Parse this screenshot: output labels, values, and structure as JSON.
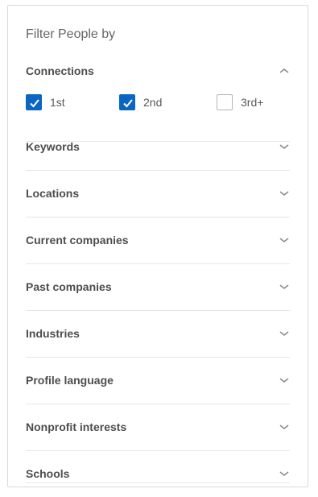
{
  "panel": {
    "title": "Filter People by"
  },
  "connections": {
    "label": "Connections",
    "expanded": true,
    "options": [
      {
        "label": "1st",
        "checked": true
      },
      {
        "label": "2nd",
        "checked": true
      },
      {
        "label": "3rd+",
        "checked": false
      }
    ]
  },
  "filters": [
    {
      "label": "Keywords"
    },
    {
      "label": "Locations"
    },
    {
      "label": "Current companies"
    },
    {
      "label": "Past companies"
    },
    {
      "label": "Industries"
    },
    {
      "label": "Profile language"
    },
    {
      "label": "Nonprofit interests"
    },
    {
      "label": "Schools"
    }
  ],
  "colors": {
    "checkbox_checked": "#0a66c2",
    "divider": "#e6e6e6",
    "label_text": "#4d4d4d"
  },
  "icons": {
    "expanded": "chevron-up-icon",
    "collapsed": "chevron-down-icon",
    "checked": "checkmark-icon"
  }
}
